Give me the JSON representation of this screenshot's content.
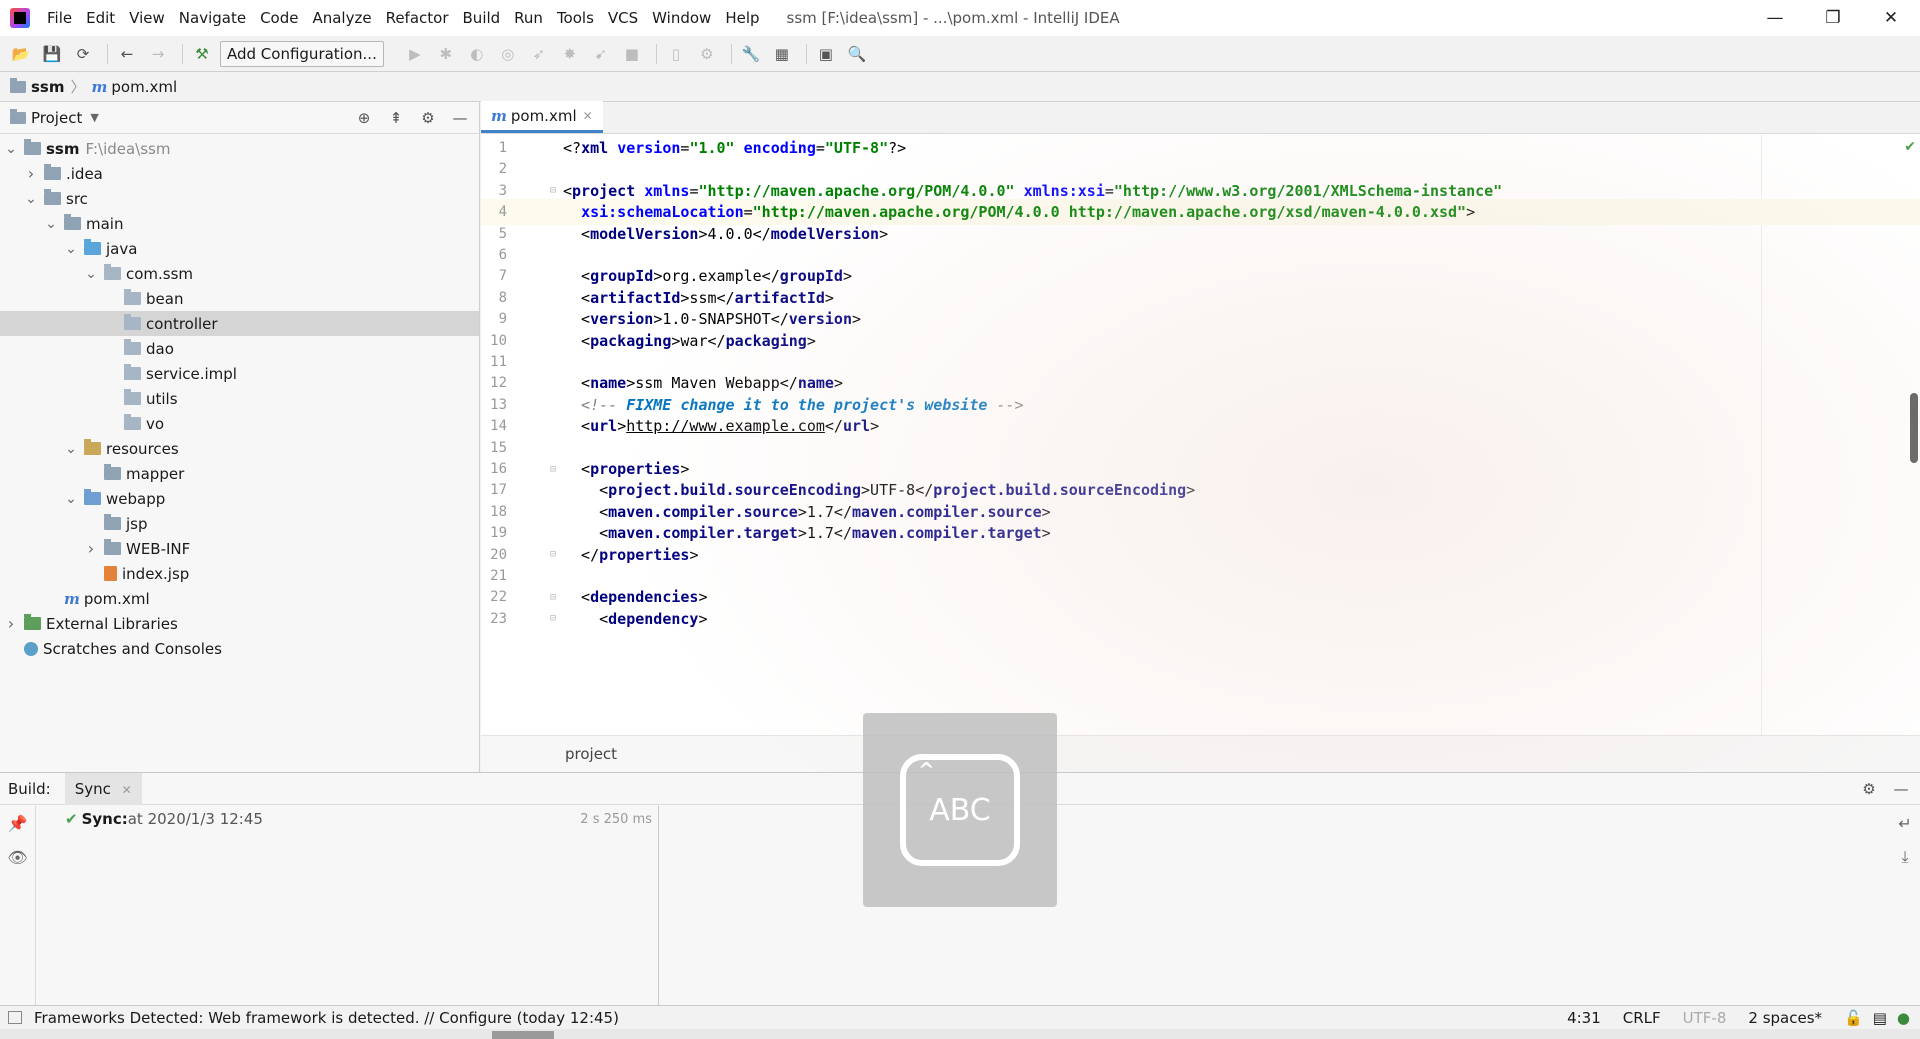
{
  "window": {
    "title": "ssm [F:\\idea\\ssm] - ...\\pom.xml - IntelliJ IDEA",
    "minimize": "—",
    "restore": "❐",
    "close": "✕"
  },
  "menu": [
    "File",
    "Edit",
    "View",
    "Navigate",
    "Code",
    "Analyze",
    "Refactor",
    "Build",
    "Run",
    "Tools",
    "VCS",
    "Window",
    "Help"
  ],
  "toolbar": {
    "add_configuration": "Add Configuration..."
  },
  "breadcrumb": {
    "project": "ssm",
    "file": "pom.xml"
  },
  "project_panel": {
    "title": "Project",
    "tree": [
      {
        "label": "ssm",
        "extra": "F:\\idea\\ssm",
        "depth": 0,
        "arrow": "v",
        "icon": "grey",
        "bold": true
      },
      {
        "label": ".idea",
        "depth": 1,
        "arrow": ">",
        "icon": "grey"
      },
      {
        "label": "src",
        "depth": 1,
        "arrow": "v",
        "icon": "grey"
      },
      {
        "label": "main",
        "depth": 2,
        "arrow": "v",
        "icon": "grey"
      },
      {
        "label": "java",
        "depth": 3,
        "arrow": "v",
        "icon": "blue"
      },
      {
        "label": "com.ssm",
        "depth": 4,
        "arrow": "v",
        "icon": "pkg"
      },
      {
        "label": "bean",
        "depth": 5,
        "arrow": "",
        "icon": "pkg"
      },
      {
        "label": "controller",
        "depth": 5,
        "arrow": "",
        "icon": "pkg",
        "selected": true
      },
      {
        "label": "dao",
        "depth": 5,
        "arrow": "",
        "icon": "pkg"
      },
      {
        "label": "service.impl",
        "depth": 5,
        "arrow": "",
        "icon": "pkg"
      },
      {
        "label": "utils",
        "depth": 5,
        "arrow": "",
        "icon": "pkg"
      },
      {
        "label": "vo",
        "depth": 5,
        "arrow": "",
        "icon": "pkg"
      },
      {
        "label": "resources",
        "depth": 3,
        "arrow": "v",
        "icon": "res"
      },
      {
        "label": "mapper",
        "depth": 4,
        "arrow": "",
        "icon": "grey"
      },
      {
        "label": "webapp",
        "depth": 3,
        "arrow": "v",
        "icon": "web"
      },
      {
        "label": "jsp",
        "depth": 4,
        "arrow": "",
        "icon": "grey"
      },
      {
        "label": "WEB-INF",
        "depth": 4,
        "arrow": ">",
        "icon": "grey"
      },
      {
        "label": "index.jsp",
        "depth": 4,
        "arrow": "",
        "icon": "jsp"
      },
      {
        "label": "pom.xml",
        "depth": 2,
        "arrow": "",
        "icon": "maven"
      },
      {
        "label": "External Libraries",
        "depth": 0,
        "arrow": ">",
        "icon": "lib"
      },
      {
        "label": "Scratches and Consoles",
        "depth": 0,
        "arrow": "",
        "icon": "scratch"
      }
    ]
  },
  "editor": {
    "tab": "pom.xml",
    "breadcrumb": "project",
    "current_line": 4,
    "lines": [
      {
        "n": "1",
        "tokens": [
          [
            "p",
            "<?"
          ],
          [
            "t",
            "xml"
          ],
          [
            "p",
            " "
          ],
          [
            "a",
            "version"
          ],
          [
            "p",
            "="
          ],
          [
            "v",
            "\"1.0\""
          ],
          [
            "p",
            " "
          ],
          [
            "a",
            "encoding"
          ],
          [
            "p",
            "="
          ],
          [
            "v",
            "\"UTF-8\""
          ],
          [
            "p",
            "?>"
          ]
        ]
      },
      {
        "n": "2",
        "tokens": []
      },
      {
        "n": "3",
        "fold": true,
        "tokens": [
          [
            "p",
            "<"
          ],
          [
            "t",
            "project"
          ],
          [
            "p",
            " "
          ],
          [
            "a",
            "xmlns"
          ],
          [
            "p",
            "="
          ],
          [
            "v",
            "\"http://maven.apache.org/POM/4.0.0\""
          ],
          [
            "p",
            " "
          ],
          [
            "a",
            "xmlns:xsi"
          ],
          [
            "p",
            "="
          ],
          [
            "v",
            "\"http://www.w3.org/2001/XMLSchema-instance\""
          ]
        ]
      },
      {
        "n": "4",
        "tokens": [
          [
            "p",
            "  "
          ],
          [
            "a",
            "xsi:schemaLocation"
          ],
          [
            "p",
            "="
          ],
          [
            "v",
            "\"http://maven.apache.org/POM/4.0.0 http://maven.apache.org/xsd/maven-4.0.0.xsd\""
          ],
          [
            "p",
            ">"
          ]
        ]
      },
      {
        "n": "5",
        "tokens": [
          [
            "p",
            "  <"
          ],
          [
            "t",
            "modelVersion"
          ],
          [
            "p",
            ">4.0.0</"
          ],
          [
            "t",
            "modelVersion"
          ],
          [
            "p",
            ">"
          ]
        ]
      },
      {
        "n": "6",
        "tokens": []
      },
      {
        "n": "7",
        "tokens": [
          [
            "p",
            "  <"
          ],
          [
            "t",
            "groupId"
          ],
          [
            "p",
            ">org.example</"
          ],
          [
            "t",
            "groupId"
          ],
          [
            "p",
            ">"
          ]
        ]
      },
      {
        "n": "8",
        "tokens": [
          [
            "p",
            "  <"
          ],
          [
            "t",
            "artifactId"
          ],
          [
            "p",
            ">ssm</"
          ],
          [
            "t",
            "artifactId"
          ],
          [
            "p",
            ">"
          ]
        ]
      },
      {
        "n": "9",
        "tokens": [
          [
            "p",
            "  <"
          ],
          [
            "t",
            "version"
          ],
          [
            "p",
            ">1.0-SNAPSHOT</"
          ],
          [
            "t",
            "version"
          ],
          [
            "p",
            ">"
          ]
        ]
      },
      {
        "n": "10",
        "tokens": [
          [
            "p",
            "  <"
          ],
          [
            "t",
            "packaging"
          ],
          [
            "p",
            ">war</"
          ],
          [
            "t",
            "packaging"
          ],
          [
            "p",
            ">"
          ]
        ]
      },
      {
        "n": "11",
        "tokens": []
      },
      {
        "n": "12",
        "tokens": [
          [
            "p",
            "  <"
          ],
          [
            "t",
            "name"
          ],
          [
            "p",
            ">ssm Maven Webapp</"
          ],
          [
            "t",
            "name"
          ],
          [
            "p",
            ">"
          ]
        ]
      },
      {
        "n": "13",
        "tokens": [
          [
            "c",
            "  <!-- "
          ],
          [
            "d",
            "FIXME change it to the project's website"
          ],
          [
            "c",
            " -->"
          ]
        ]
      },
      {
        "n": "14",
        "tokens": [
          [
            "p",
            "  <"
          ],
          [
            "t",
            "url"
          ],
          [
            "p",
            ">"
          ],
          [
            "u",
            "http://www.example.com"
          ],
          [
            "p",
            "</"
          ],
          [
            "t",
            "url"
          ],
          [
            "p",
            ">"
          ]
        ]
      },
      {
        "n": "15",
        "tokens": []
      },
      {
        "n": "16",
        "fold": true,
        "tokens": [
          [
            "p",
            "  <"
          ],
          [
            "t",
            "properties"
          ],
          [
            "p",
            ">"
          ]
        ]
      },
      {
        "n": "17",
        "tokens": [
          [
            "p",
            "    <"
          ],
          [
            "t",
            "project.build.sourceEncoding"
          ],
          [
            "p",
            ">UTF-8</"
          ],
          [
            "t",
            "project.build.sourceEncoding"
          ],
          [
            "p",
            ">"
          ]
        ]
      },
      {
        "n": "18",
        "tokens": [
          [
            "p",
            "    <"
          ],
          [
            "t",
            "maven.compiler.source"
          ],
          [
            "p",
            ">1.7</"
          ],
          [
            "t",
            "maven.compiler.source"
          ],
          [
            "p",
            ">"
          ]
        ]
      },
      {
        "n": "19",
        "tokens": [
          [
            "p",
            "    <"
          ],
          [
            "t",
            "maven.compiler.target"
          ],
          [
            "p",
            ">1.7</"
          ],
          [
            "t",
            "maven.compiler.target"
          ],
          [
            "p",
            ">"
          ]
        ]
      },
      {
        "n": "20",
        "fold": true,
        "tokens": [
          [
            "p",
            "  </"
          ],
          [
            "t",
            "properties"
          ],
          [
            "p",
            ">"
          ]
        ]
      },
      {
        "n": "21",
        "tokens": []
      },
      {
        "n": "22",
        "fold": true,
        "tokens": [
          [
            "p",
            "  <"
          ],
          [
            "t",
            "dependencies"
          ],
          [
            "p",
            ">"
          ]
        ]
      },
      {
        "n": "23",
        "fold": true,
        "tokens": [
          [
            "p",
            "    <"
          ],
          [
            "t",
            "dependency"
          ],
          [
            "p",
            ">"
          ]
        ]
      }
    ]
  },
  "build": {
    "label": "Build:",
    "tab": "Sync",
    "row_bold": "Sync:",
    "row_text": " at 2020/1/3 12:45",
    "row_time": "2 s 250 ms"
  },
  "ime": {
    "label": "ABC"
  },
  "status": {
    "message": "Frameworks Detected: Web framework is detected. // Configure (today 12:45)",
    "position": "4:31",
    "line_sep": "CRLF",
    "encoding": "UTF-8",
    "indent": "2 spaces*"
  }
}
